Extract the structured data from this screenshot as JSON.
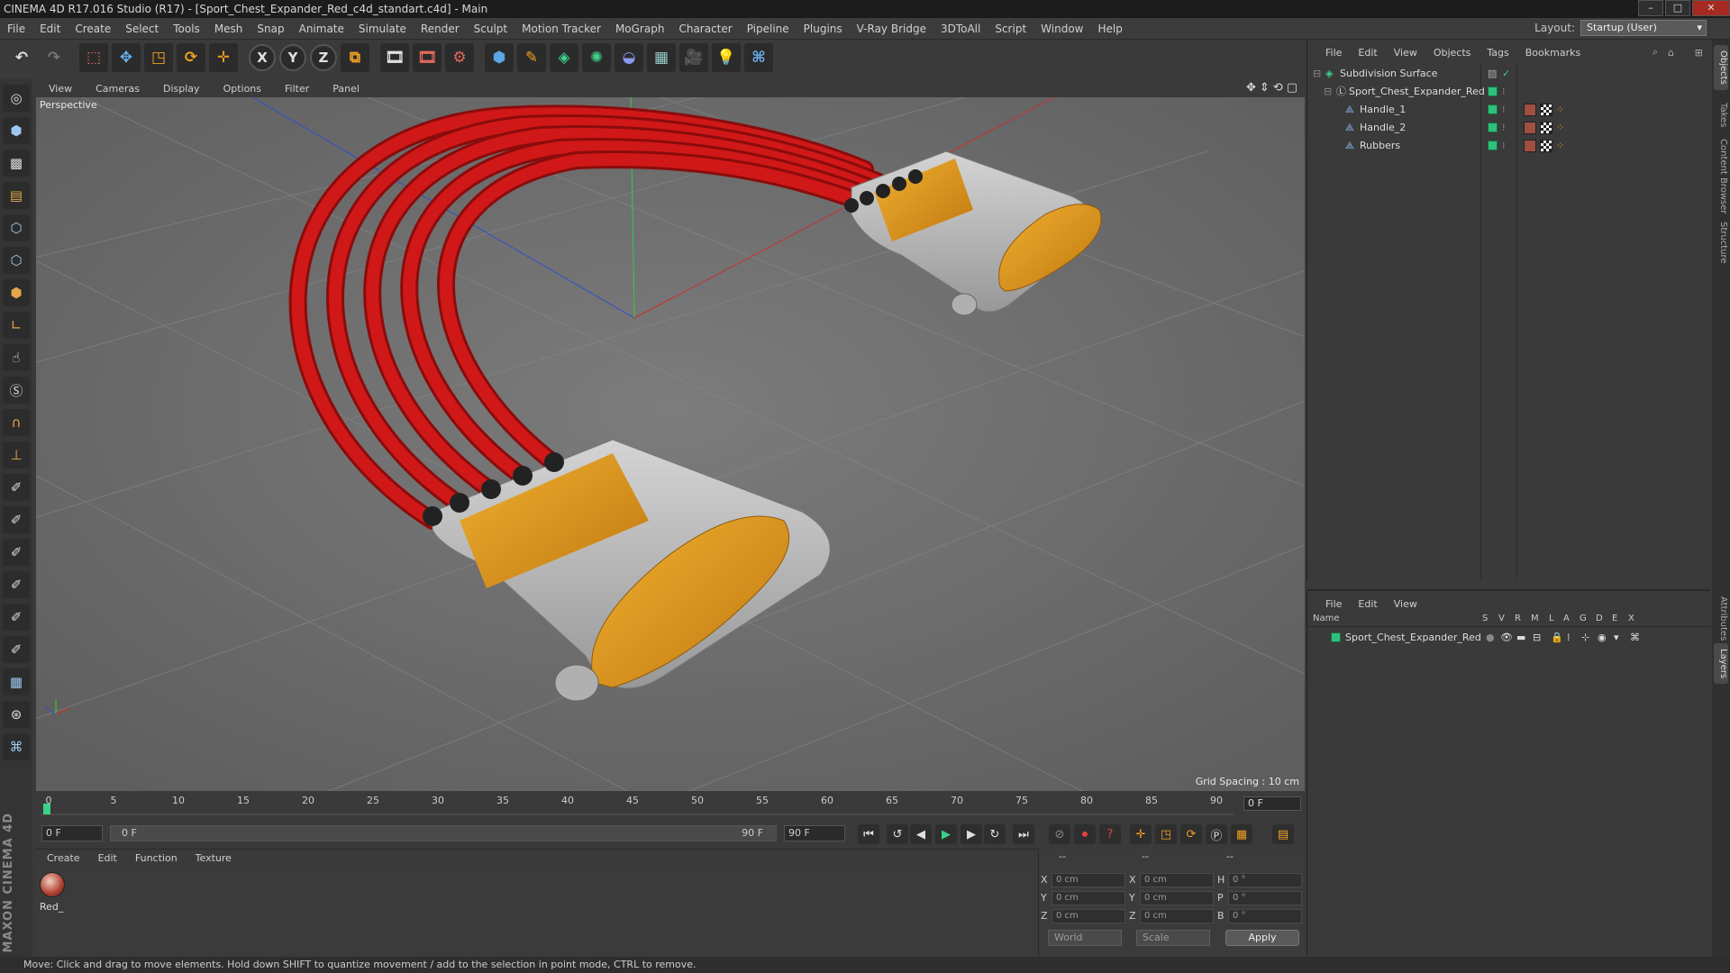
{
  "window": {
    "title": "CINEMA 4D R17.016 Studio (R17) - [Sport_Chest_Expander_Red_c4d_standart.c4d] - Main"
  },
  "menu": [
    "File",
    "Edit",
    "Create",
    "Select",
    "Tools",
    "Mesh",
    "Snap",
    "Animate",
    "Simulate",
    "Render",
    "Sculpt",
    "Motion Tracker",
    "MoGraph",
    "Character",
    "Pipeline",
    "Plugins",
    "V-Ray Bridge",
    "3DToAll",
    "Script",
    "Window",
    "Help"
  ],
  "layout": {
    "label": "Layout:",
    "value": "Startup (User)"
  },
  "toolbar": {
    "x_label": "X",
    "y_label": "Y",
    "z_label": "Z"
  },
  "viewport": {
    "menu": [
      "View",
      "Cameras",
      "Display",
      "Options",
      "Filter",
      "Panel"
    ],
    "label": "Perspective",
    "grid_spacing": "Grid Spacing : 10 cm"
  },
  "timeline": {
    "ticks": [
      "0",
      "5",
      "10",
      "15",
      "20",
      "25",
      "30",
      "35",
      "40",
      "45",
      "50",
      "55",
      "60",
      "65",
      "70",
      "75",
      "80",
      "85",
      "90"
    ],
    "current_frame": "0 F",
    "start_field": "0 F",
    "range_start": "0 F",
    "range_end": "90 F",
    "end_field": "90 F"
  },
  "materials": {
    "menu": [
      "Create",
      "Edit",
      "Function",
      "Texture"
    ],
    "items": [
      {
        "label": "Red_"
      }
    ]
  },
  "coords": {
    "headers": [
      "--",
      "--",
      "--"
    ],
    "rows": [
      {
        "a": "X",
        "av": "0 cm",
        "b": "X",
        "bv": "0 cm",
        "c": "H",
        "cv": "0 °"
      },
      {
        "a": "Y",
        "av": "0 cm",
        "b": "Y",
        "bv": "0 cm",
        "c": "P",
        "cv": "0 °"
      },
      {
        "a": "Z",
        "av": "0 cm",
        "b": "Z",
        "bv": "0 cm",
        "c": "B",
        "cv": "0 °"
      }
    ],
    "space": "World",
    "mode": "Scale",
    "apply": "Apply"
  },
  "status": "Move: Click and drag to move elements. Hold down SHIFT to quantize movement / add to the selection in point mode, CTRL to remove.",
  "objects": {
    "menu": [
      "File",
      "Edit",
      "View",
      "Objects",
      "Tags",
      "Bookmarks"
    ],
    "items": [
      {
        "name": "Subdivision Surface"
      },
      {
        "name": "Sport_Chest_Expander_Red"
      },
      {
        "name": "Handle_1"
      },
      {
        "name": "Handle_2"
      },
      {
        "name": "Rubbers"
      }
    ]
  },
  "layers": {
    "menu": [
      "File",
      "Edit",
      "View"
    ],
    "columns": [
      "Name",
      "S",
      "V",
      "R",
      "M",
      "L",
      "A",
      "G",
      "D",
      "E",
      "X"
    ],
    "items": [
      {
        "name": "Sport_Chest_Expander_Red"
      }
    ]
  },
  "side_tabs": [
    "Objects",
    "Takes",
    "Content Browser",
    "Structure",
    "Attributes",
    "Layers"
  ],
  "brand": "MAXON CINEMA 4D",
  "colors": {
    "layer_green": "#2ec07a",
    "rubber_red": "#c81414",
    "handle_orange": "#e8a020",
    "handle_grey": "#b8b8b8",
    "viewport_bg": "#6f6f6f"
  }
}
